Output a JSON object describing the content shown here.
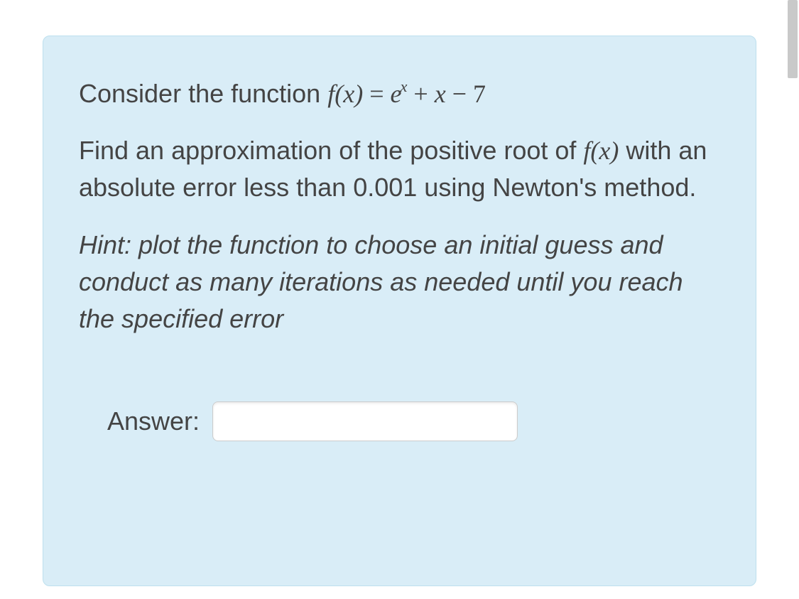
{
  "problem": {
    "intro_prefix": "Consider the function ",
    "fx": "f(x)",
    "eq_mid": " = ",
    "e_base": "e",
    "e_exp": "x",
    "rhs_tail_1": " + ",
    "rhs_var": "x",
    "rhs_tail_2": " − 7",
    "p2a": "Find an approximation of the positive root of ",
    "p2b": " with an absolute error less than 0.001 using Newton's method.",
    "hint": "Hint: plot the function to choose an initial guess and conduct as many iterations as needed until you reach the specified error",
    "answer_label": "Answer:",
    "answer_value": ""
  }
}
